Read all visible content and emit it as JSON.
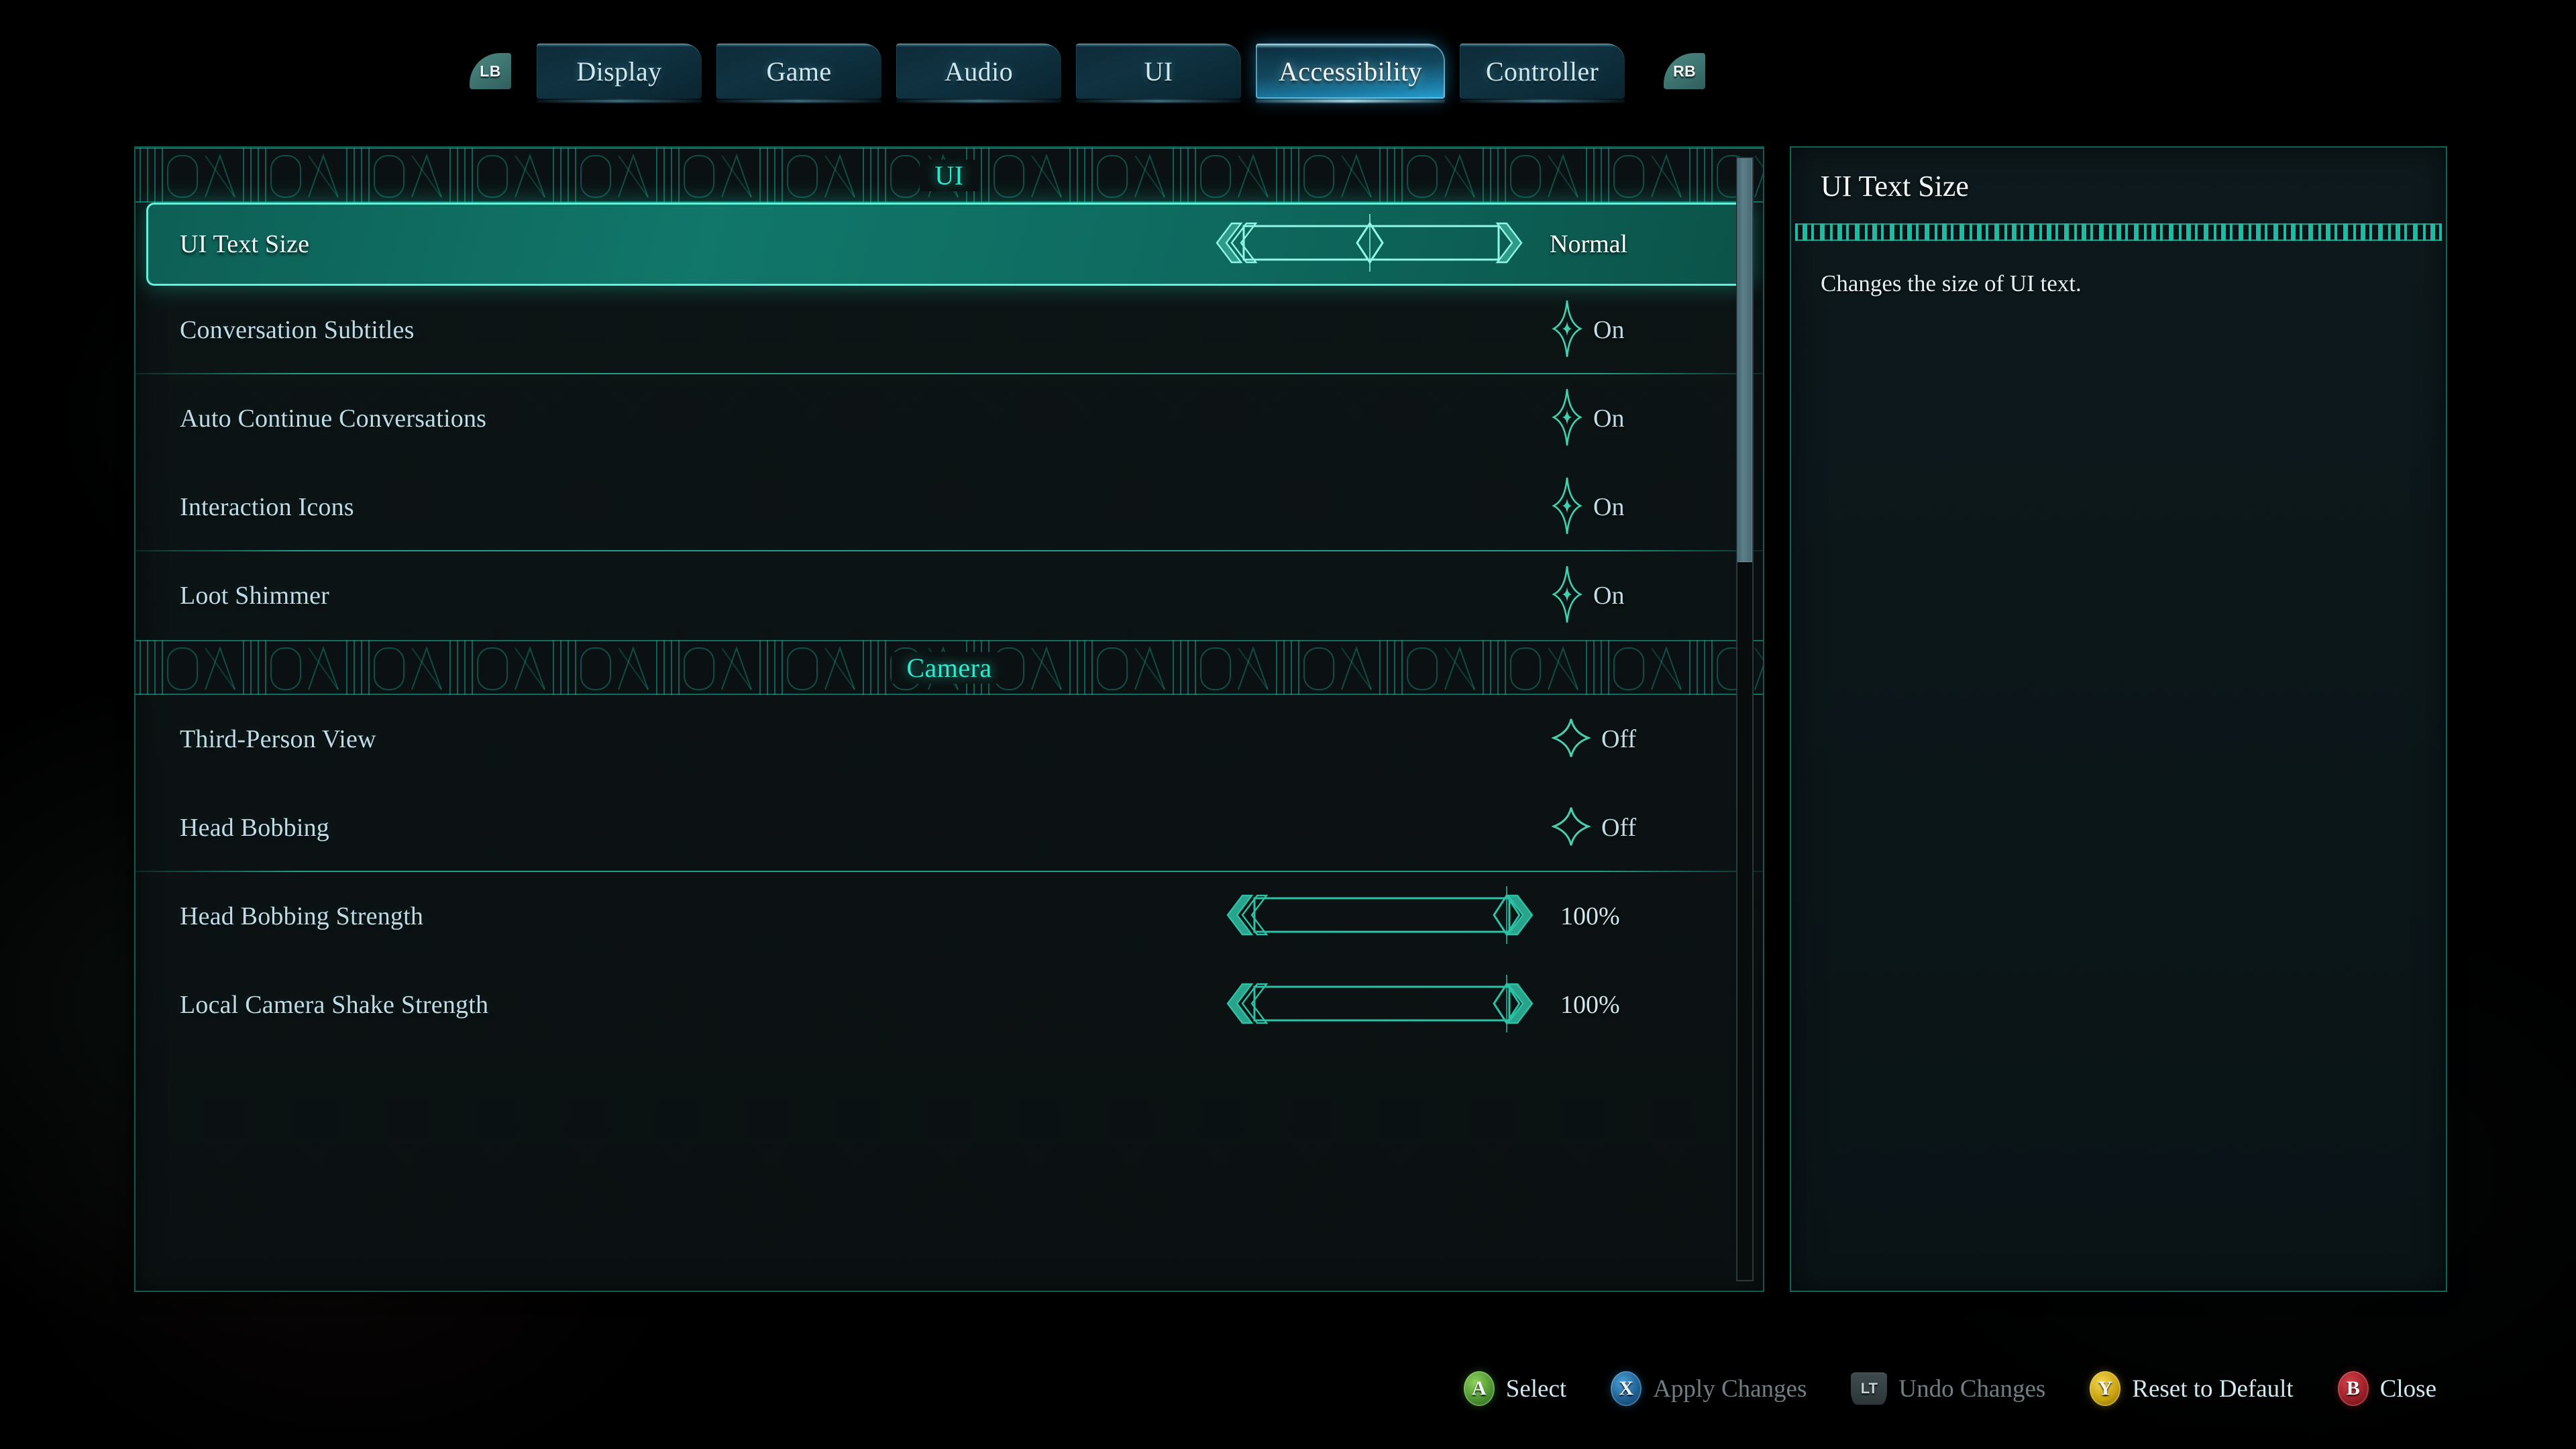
{
  "tabs": {
    "bumper_left": "LB",
    "bumper_right": "RB",
    "items": [
      {
        "label": "Display",
        "active": false
      },
      {
        "label": "Game",
        "active": false
      },
      {
        "label": "Audio",
        "active": false
      },
      {
        "label": "UI",
        "active": false
      },
      {
        "label": "Accessibility",
        "active": true
      },
      {
        "label": "Controller",
        "active": false
      }
    ]
  },
  "settings": {
    "sections": [
      {
        "header": "UI",
        "rows": [
          {
            "label": "UI Text Size",
            "type": "slider",
            "value": "Normal",
            "fill": 50,
            "selected": true
          },
          {
            "label": "Conversation Subtitles",
            "type": "toggle",
            "value": "On",
            "on": true,
            "selected": false
          },
          {
            "label": "Auto Continue Conversations",
            "type": "toggle",
            "value": "On",
            "on": true,
            "selected": false
          },
          {
            "label": "Interaction Icons",
            "type": "toggle",
            "value": "On",
            "on": true,
            "selected": false
          },
          {
            "label": "Loot Shimmer",
            "type": "toggle",
            "value": "On",
            "on": true,
            "selected": false
          }
        ]
      },
      {
        "header": "Camera",
        "rows": [
          {
            "label": "Third-Person View",
            "type": "toggle",
            "value": "Off",
            "on": false,
            "selected": false
          },
          {
            "label": "Head Bobbing",
            "type": "toggle",
            "value": "Off",
            "on": false,
            "selected": false
          },
          {
            "label": "Head Bobbing Strength",
            "type": "slider",
            "value": "100%",
            "fill": 100,
            "selected": false
          },
          {
            "label": "Local Camera Shake Strength",
            "type": "slider",
            "value": "100%",
            "fill": 100,
            "selected": false
          }
        ]
      }
    ],
    "scroll_percent": 36
  },
  "info": {
    "title": "UI Text Size",
    "description": "Changes the size of UI text."
  },
  "footer": {
    "hints": [
      {
        "button": "A",
        "label": "Select",
        "style": "a",
        "dim": false
      },
      {
        "button": "X",
        "label": "Apply Changes",
        "style": "x",
        "dim": true
      },
      {
        "button": "LT",
        "label": "Undo Changes",
        "style": "trigger",
        "dim": true
      },
      {
        "button": "Y",
        "label": "Reset to Default",
        "style": "y",
        "dim": false
      },
      {
        "button": "B",
        "label": "Close",
        "style": "b",
        "dim": false
      }
    ]
  },
  "colors": {
    "accent_teal": "#1eb9a0",
    "accent_cyan": "#2fe8cd",
    "highlight_row": "#11776a",
    "tab_active": "#27a2d4",
    "text_primary": "#bfdde6",
    "panel_bg": "#0d1415"
  }
}
